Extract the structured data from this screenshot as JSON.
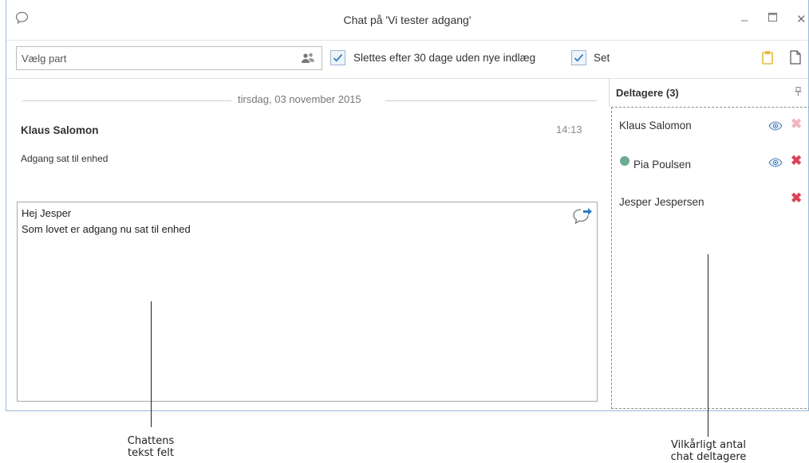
{
  "window": {
    "title": "Chat på 'Vi tester adgang'",
    "minimize": "–",
    "maximize": "☐",
    "close": "✕"
  },
  "toolbar": {
    "party_placeholder": "Vælg part",
    "delete_checkbox_label": "Slettes efter 30 dage uden nye indlæg",
    "delete_checked": true,
    "seen_checkbox_label": "Set",
    "seen_checked": true
  },
  "chat": {
    "date": "tirsdag, 03 november 2015",
    "sender": "Klaus Salomon",
    "time": "14:13",
    "message": "Adgang sat til enhed"
  },
  "compose": {
    "line1": "Hej Jesper",
    "line2": "Som lovet er adgang nu sat til enhed"
  },
  "participants": {
    "title": "Deltagere (3)",
    "items": [
      {
        "name": "Klaus Salomon",
        "online": false,
        "seen": true,
        "remove_enabled": false
      },
      {
        "name": "Pia Poulsen",
        "online": true,
        "seen": true,
        "remove_enabled": true
      },
      {
        "name": "Jesper Jespersen",
        "online": false,
        "seen": false,
        "remove_enabled": true
      }
    ]
  },
  "annotations": {
    "chat_field_line1": "Chattens",
    "chat_field_line2": "tekst felt",
    "participants_line1": "Vilkårligt antal",
    "participants_line2": "chat deltagere"
  },
  "colors": {
    "accent": "#2f7ec1",
    "remove_active": "#d9425a",
    "remove_disabled": "#f0b7c2",
    "online": "#6cab8f",
    "clipboard": "#e8b93a"
  }
}
